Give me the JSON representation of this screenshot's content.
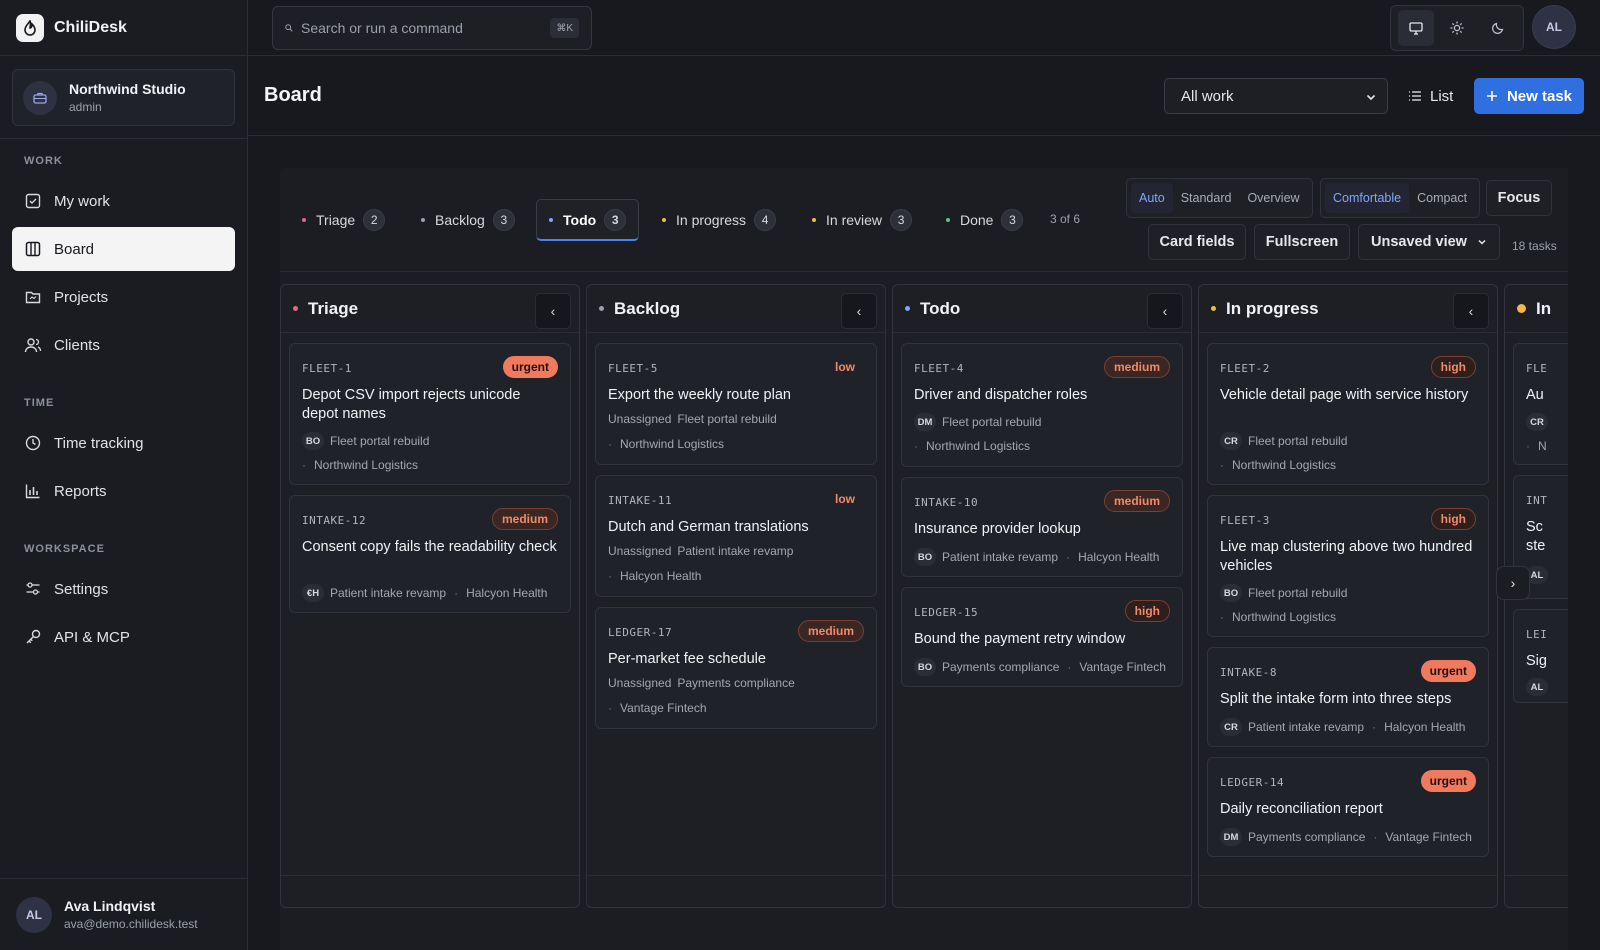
{
  "app": {
    "name": "ChiliDesk"
  },
  "org": {
    "name": "Northwind Studio",
    "role": "admin"
  },
  "nav": {
    "sections": [
      {
        "label": "WORK",
        "items": [
          {
            "label": "My work",
            "icon": "check-square-icon"
          },
          {
            "label": "Board",
            "icon": "columns-icon",
            "active": true
          },
          {
            "label": "Projects",
            "icon": "folder-icon"
          },
          {
            "label": "Clients",
            "icon": "users-icon"
          }
        ]
      },
      {
        "label": "TIME",
        "items": [
          {
            "label": "Time tracking",
            "icon": "clock-icon"
          },
          {
            "label": "Reports",
            "icon": "bar-chart-icon"
          }
        ]
      },
      {
        "label": "WORKSPACE",
        "items": [
          {
            "label": "Settings",
            "icon": "sliders-icon"
          },
          {
            "label": "API & MCP",
            "icon": "key-icon"
          }
        ]
      }
    ]
  },
  "user": {
    "initials": "AL",
    "name": "Ava Lindqvist",
    "email": "ava@demo.chilidesk.test"
  },
  "topbar": {
    "search_placeholder": "Search or run a command",
    "shortcut": "⌘K",
    "avatar": "AL"
  },
  "header": {
    "title": "Board",
    "filter": "All work",
    "list_label": "List",
    "new_task_label": "New task"
  },
  "tabs": [
    {
      "label": "Triage",
      "count": "2",
      "color": "#e06a86"
    },
    {
      "label": "Backlog",
      "count": "3",
      "color": "#9ca0aa"
    },
    {
      "label": "Todo",
      "count": "3",
      "color": "#7ea6ff",
      "active": true
    },
    {
      "label": "In progress",
      "count": "4",
      "color": "#f2b84b"
    },
    {
      "label": "In review",
      "count": "3",
      "color": "#f2b84b"
    },
    {
      "label": "Done",
      "count": "3",
      "color": "#5ec48a"
    }
  ],
  "tabs_summary": "3 of 6",
  "layout_modes": [
    "Auto",
    "Standard",
    "Overview"
  ],
  "density_modes": [
    "Comfortable",
    "Compact"
  ],
  "toolbar": {
    "focus": "Focus",
    "card_fields": "Card fields",
    "fullscreen": "Fullscreen",
    "view": "Unsaved view",
    "task_count": "18 tasks"
  },
  "columns": [
    {
      "title": "Triage",
      "color": "#e06a86",
      "cards": [
        {
          "id": "FLEET-1",
          "priority": "urgent",
          "title": "Depot CSV import rejects unicode depot names",
          "assignee": "BO",
          "project": "Fleet portal rebuild",
          "client": "Northwind Logistics"
        },
        {
          "id": "INTAKE-12",
          "priority": "medium",
          "title": "Consent copy fails the readability check",
          "assignee": "€H",
          "project": "Patient intake revamp",
          "client": "Halcyon Health"
        }
      ]
    },
    {
      "title": "Backlog",
      "color": "#9ca0aa",
      "cards": [
        {
          "id": "FLEET-5",
          "priority": "low",
          "title": "Export the weekly route plan",
          "assignee": "Unassigned",
          "project": "Fleet portal rebuild",
          "client": "Northwind Logistics"
        },
        {
          "id": "INTAKE-11",
          "priority": "low",
          "title": "Dutch and German translations",
          "assignee": "Unassigned",
          "project": "Patient intake revamp",
          "client": "Halcyon Health"
        },
        {
          "id": "LEDGER-17",
          "priority": "medium",
          "title": "Per-market fee schedule",
          "assignee": "Unassigned",
          "project": "Payments compliance",
          "client": "Vantage Fintech"
        }
      ]
    },
    {
      "title": "Todo",
      "color": "#7ea6ff",
      "cards": [
        {
          "id": "FLEET-4",
          "priority": "medium",
          "title": "Driver and dispatcher roles",
          "assignee": "DM",
          "project": "Fleet portal rebuild",
          "client": "Northwind Logistics"
        },
        {
          "id": "INTAKE-10",
          "priority": "medium",
          "title": "Insurance provider lookup",
          "assignee": "BO",
          "project": "Patient intake revamp",
          "client": "Halcyon Health"
        },
        {
          "id": "LEDGER-15",
          "priority": "high",
          "title": "Bound the payment retry window",
          "assignee": "BO",
          "project": "Payments compliance",
          "client": "Vantage Fintech"
        }
      ]
    },
    {
      "title": "In progress",
      "color": "#f2b84b",
      "cards": [
        {
          "id": "FLEET-2",
          "priority": "high",
          "title": "Vehicle detail page with service history",
          "assignee": "CR",
          "project": "Fleet portal rebuild",
          "client": "Northwind Logistics"
        },
        {
          "id": "FLEET-3",
          "priority": "high",
          "title": "Live map clustering above two hundred vehicles",
          "assignee": "BO",
          "project": "Fleet portal rebuild",
          "client": "Northwind Logistics"
        },
        {
          "id": "INTAKE-8",
          "priority": "urgent",
          "title": "Split the intake form into three steps",
          "assignee": "CR",
          "project": "Patient intake revamp",
          "client": "Halcyon Health"
        },
        {
          "id": "LEDGER-14",
          "priority": "urgent",
          "title": "Daily reconciliation report",
          "assignee": "DM",
          "project": "Payments compliance",
          "client": "Vantage Fintech"
        }
      ]
    },
    {
      "title": "In",
      "color": "#f2b84b",
      "cards": [
        {
          "id": "FLE",
          "title": "Au",
          "assignee": "CR",
          "client": "N"
        },
        {
          "id": "INT",
          "title": "Sc ste",
          "assignee": "AL"
        },
        {
          "id": "LEI",
          "title": "Sig",
          "assignee": "AL"
        }
      ]
    }
  ]
}
